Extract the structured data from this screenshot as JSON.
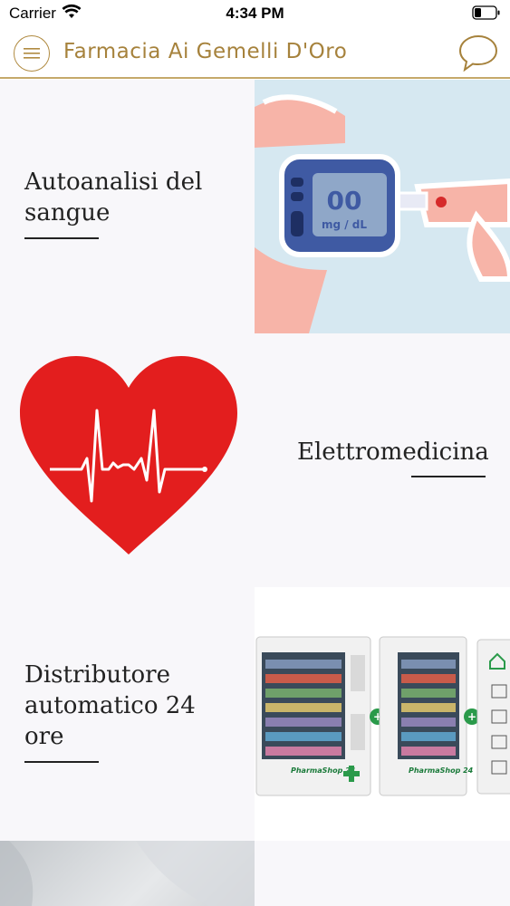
{
  "status_bar": {
    "carrier": "Carrier",
    "time": "4:34 PM",
    "icons": [
      "wifi-icon",
      "battery-icon"
    ]
  },
  "header": {
    "title": "Farmacia Ai Gemelli D'Oro",
    "menu_icon": "menu-icon",
    "chat_icon": "chat-bubble-icon",
    "accent_color": "#a6823c"
  },
  "items": [
    {
      "label": "Autoanalisi del sangue",
      "image": "glucose-meter-illustration"
    },
    {
      "label": "Elettromedicina",
      "image": "heart-ecg-illustration"
    },
    {
      "label": "Distributore automatico 24 ore",
      "image": "vending-machine-photo",
      "image_texts": [
        "PharmaShop 24",
        "PharmaShop 24"
      ]
    },
    {
      "label": "",
      "image": "pharmacist-photo"
    }
  ]
}
